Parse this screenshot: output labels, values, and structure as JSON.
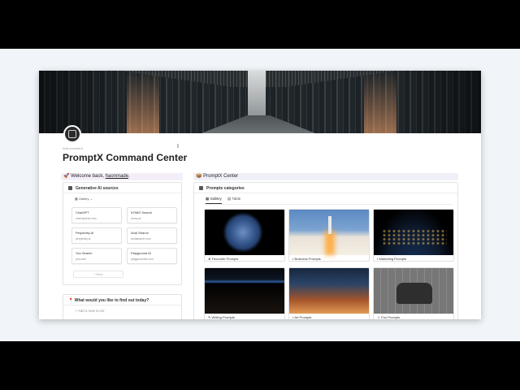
{
  "page": {
    "add_comment": "Add comment",
    "title": "PromptX Command Center"
  },
  "welcome": {
    "prefix": "🚀 Welcome back, ",
    "username": "haonmade",
    "suffix": "."
  },
  "center_callout": "📦 PromptX Center",
  "sources": {
    "title": "Generative AI sources",
    "view": "Gallery",
    "items": [
      {
        "name": "ChatGPT",
        "url": "chat.openai.com"
      },
      {
        "name": "KOMO Search",
        "url": "komo.ai"
      },
      {
        "name": "Perplexity AI",
        "url": "perplexity.ai"
      },
      {
        "name": "Andi Search",
        "url": "andisearch.com"
      },
      {
        "name": "You Search",
        "url": "you.com"
      },
      {
        "name": "Playground AI",
        "url": "playgroundai.com"
      }
    ],
    "new_label": "+ New"
  },
  "todo": {
    "title": "What would you like to find out today?",
    "add_label": "+ Add a new to-do"
  },
  "prompts": {
    "title": "Prompts categories",
    "tabs": [
      "Gallery",
      "Table"
    ],
    "cards": [
      {
        "label": "Favourite Prompts",
        "image": "earth"
      },
      {
        "label": "Business Prompts",
        "image": "shuttle-launch"
      },
      {
        "label": "Marketing Prompts",
        "image": "earth-night"
      },
      {
        "label": "Writing Prompts",
        "image": "orbit-horizon"
      },
      {
        "label": "Art Prompts",
        "image": "nebula"
      },
      {
        "label": "Fun Prompts",
        "image": "lab-photo"
      }
    ]
  },
  "help": "?"
}
